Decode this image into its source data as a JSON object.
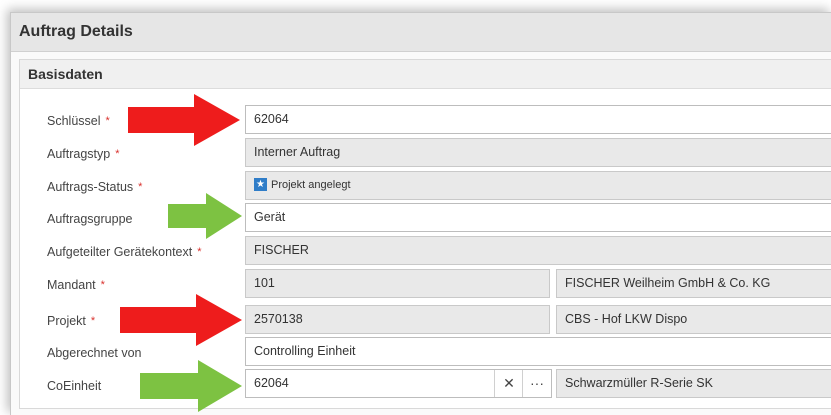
{
  "header": {
    "title": "Auftrag Details"
  },
  "section": {
    "title": "Basisdaten"
  },
  "fields": {
    "schluessel": {
      "label": "Schlüssel",
      "value": "62064",
      "required_mark": "*"
    },
    "auftragstyp": {
      "label": "Auftragstyp",
      "value": "Interner Auftrag",
      "required_mark": "*"
    },
    "auftrags_status": {
      "label": "Auftrags-Status",
      "value": "Projekt angelegt",
      "required_mark": "*"
    },
    "auftragsgruppe": {
      "label": "Auftragsgruppe",
      "value": "Gerät"
    },
    "geraetekontext": {
      "label": "Aufgeteilter Gerätekontext",
      "value": "FISCHER",
      "required_mark": "*"
    },
    "mandant": {
      "label": "Mandant",
      "value": "101",
      "description": "FISCHER Weilheim GmbH & Co. KG",
      "required_mark": "*"
    },
    "projekt": {
      "label": "Projekt",
      "value": "2570138",
      "description": "CBS - Hof LKW Dispo",
      "required_mark": "*"
    },
    "abgerechnet_von": {
      "label": "Abgerechnet von",
      "value": "Controlling Einheit"
    },
    "coeinheit": {
      "label": "CoEinheit",
      "value": "62064",
      "description": "Schwarzmüller R-Serie SK",
      "clear_glyph": "✕",
      "more_glyph": "···"
    }
  },
  "icons": {
    "status_icon": "star-flag-icon",
    "clear_icon": "close-icon",
    "more_icon": "ellipsis-icon"
  },
  "colors": {
    "required": "#d9302c",
    "arrow_red": "#ee1c1c",
    "arrow_green": "#7dc242",
    "status_icon": "#2f7dc8"
  }
}
